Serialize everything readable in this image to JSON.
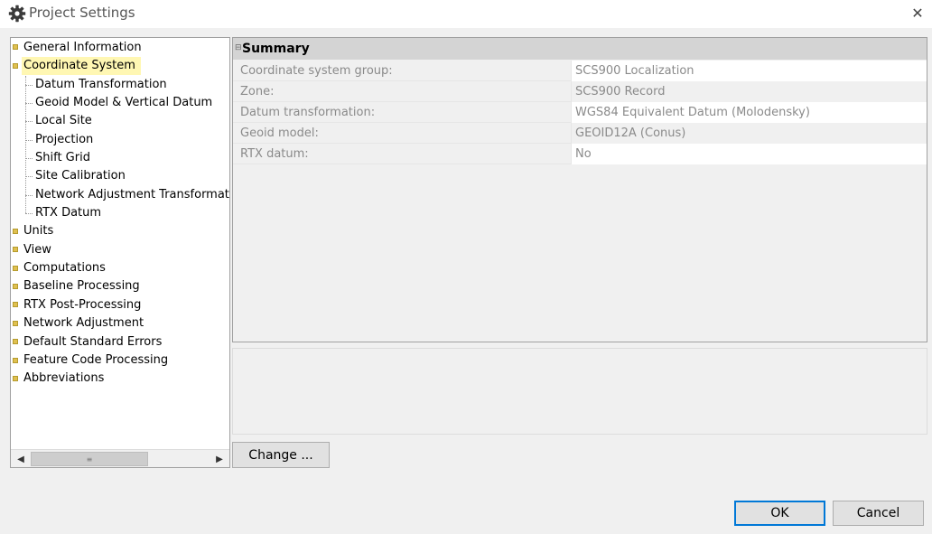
{
  "window": {
    "title": "Project Settings",
    "close_glyph": "✕",
    "icon": "gear-icon"
  },
  "tree": {
    "items": [
      {
        "label": "General Information"
      },
      {
        "label": "Coordinate System",
        "selected": true
      },
      {
        "label": "Units"
      },
      {
        "label": "View"
      },
      {
        "label": "Computations"
      },
      {
        "label": "Baseline Processing"
      },
      {
        "label": "RTX Post-Processing"
      },
      {
        "label": "Network Adjustment"
      },
      {
        "label": "Default Standard Errors"
      },
      {
        "label": "Feature Code Processing"
      },
      {
        "label": "Abbreviations"
      }
    ],
    "children": [
      {
        "label": "Datum Transformation"
      },
      {
        "label": "Geoid Model & Vertical Datum"
      },
      {
        "label": "Local Site"
      },
      {
        "label": "Projection"
      },
      {
        "label": "Shift Grid"
      },
      {
        "label": "Site Calibration"
      },
      {
        "label": "Network Adjustment Transformati"
      },
      {
        "label": "RTX Datum"
      }
    ],
    "scroll_left": "◀",
    "scroll_right": "▶",
    "scroll_grip": "≡"
  },
  "summary": {
    "collapse_glyph": "⊟",
    "title": "Summary",
    "rows": [
      {
        "label": "Coordinate system group:",
        "value": "SCS900 Localization"
      },
      {
        "label": "Zone:",
        "value": "SCS900 Record"
      },
      {
        "label": "Datum transformation:",
        "value": "WGS84 Equivalent Datum  (Molodensky)"
      },
      {
        "label": "Geoid model:",
        "value": "GEOID12A (Conus)"
      },
      {
        "label": "RTX datum:",
        "value": "No"
      }
    ]
  },
  "buttons": {
    "change": "Change ...",
    "ok": "OK",
    "cancel": "Cancel"
  },
  "colors": {
    "selection": "#fff7b3",
    "bullet": "#e0c050",
    "primary_border": "#0078d7"
  }
}
